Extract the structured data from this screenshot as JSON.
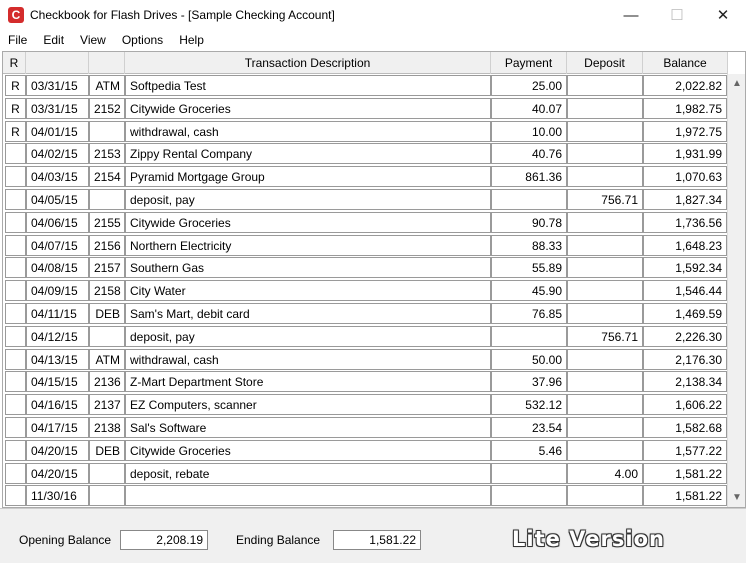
{
  "window": {
    "title": "Checkbook for Flash Drives - [Sample Checking Account]",
    "icon_letter": "C",
    "minimize": "—",
    "maximize": "☐",
    "close": "✕"
  },
  "menu": [
    "File",
    "Edit",
    "View",
    "Options",
    "Help"
  ],
  "columns": {
    "r": "R",
    "description": "Transaction Description",
    "payment": "Payment",
    "deposit": "Deposit",
    "balance": "Balance"
  },
  "rows": [
    {
      "r": "R",
      "date": "03/31/15",
      "check": "ATM",
      "desc": "Softpedia Test",
      "pay": "25.00",
      "dep": "",
      "bal": "2,022.82"
    },
    {
      "r": "R",
      "date": "03/31/15",
      "check": "2152",
      "desc": "Citywide Groceries",
      "pay": "40.07",
      "dep": "",
      "bal": "1,982.75"
    },
    {
      "r": "R",
      "date": "04/01/15",
      "check": "",
      "desc": "withdrawal, cash",
      "pay": "10.00",
      "dep": "",
      "bal": "1,972.75"
    },
    {
      "r": "",
      "date": "04/02/15",
      "check": "2153",
      "desc": "Zippy Rental Company",
      "pay": "40.76",
      "dep": "",
      "bal": "1,931.99"
    },
    {
      "r": "",
      "date": "04/03/15",
      "check": "2154",
      "desc": "Pyramid Mortgage Group",
      "pay": "861.36",
      "dep": "",
      "bal": "1,070.63"
    },
    {
      "r": "",
      "date": "04/05/15",
      "check": "",
      "desc": "deposit, pay",
      "pay": "",
      "dep": "756.71",
      "bal": "1,827.34"
    },
    {
      "r": "",
      "date": "04/06/15",
      "check": "2155",
      "desc": "Citywide Groceries",
      "pay": "90.78",
      "dep": "",
      "bal": "1,736.56"
    },
    {
      "r": "",
      "date": "04/07/15",
      "check": "2156",
      "desc": "Northern Electricity",
      "pay": "88.33",
      "dep": "",
      "bal": "1,648.23"
    },
    {
      "r": "",
      "date": "04/08/15",
      "check": "2157",
      "desc": "Southern Gas",
      "pay": "55.89",
      "dep": "",
      "bal": "1,592.34"
    },
    {
      "r": "",
      "date": "04/09/15",
      "check": "2158",
      "desc": "City Water",
      "pay": "45.90",
      "dep": "",
      "bal": "1,546.44"
    },
    {
      "r": "",
      "date": "04/11/15",
      "check": "DEB",
      "desc": "Sam's Mart, debit card",
      "pay": "76.85",
      "dep": "",
      "bal": "1,469.59"
    },
    {
      "r": "",
      "date": "04/12/15",
      "check": "",
      "desc": "deposit, pay",
      "pay": "",
      "dep": "756.71",
      "bal": "2,226.30"
    },
    {
      "r": "",
      "date": "04/13/15",
      "check": "ATM",
      "desc": "withdrawal, cash",
      "pay": "50.00",
      "dep": "",
      "bal": "2,176.30"
    },
    {
      "r": "",
      "date": "04/15/15",
      "check": "2136",
      "desc": "Z-Mart Department Store",
      "pay": "37.96",
      "dep": "",
      "bal": "2,138.34"
    },
    {
      "r": "",
      "date": "04/16/15",
      "check": "2137",
      "desc": "EZ Computers, scanner",
      "pay": "532.12",
      "dep": "",
      "bal": "1,606.22"
    },
    {
      "r": "",
      "date": "04/17/15",
      "check": "2138",
      "desc": "Sal's Software",
      "pay": "23.54",
      "dep": "",
      "bal": "1,582.68"
    },
    {
      "r": "",
      "date": "04/20/15",
      "check": "DEB",
      "desc": "Citywide Groceries",
      "pay": "5.46",
      "dep": "",
      "bal": "1,577.22"
    },
    {
      "r": "",
      "date": "04/20/15",
      "check": "",
      "desc": "deposit, rebate",
      "pay": "",
      "dep": "4.00",
      "bal": "1,581.22"
    },
    {
      "r": "",
      "date": "11/30/16",
      "check": "",
      "desc": "",
      "pay": "",
      "dep": "",
      "bal": "1,581.22"
    }
  ],
  "footer": {
    "opening_label": "Opening Balance",
    "opening_value": "2,208.19",
    "ending_label": "Ending Balance",
    "ending_value": "1,581.22",
    "lite": "Lite Version"
  }
}
